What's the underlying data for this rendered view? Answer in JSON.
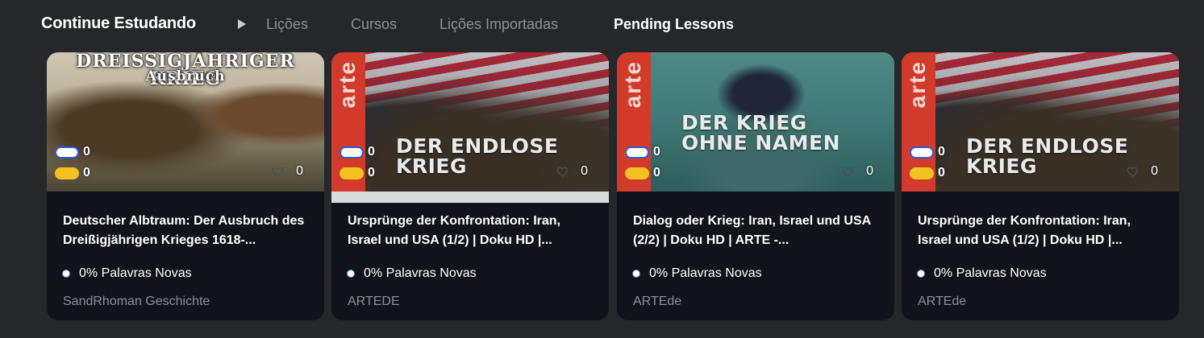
{
  "header": {
    "title": "Continue Estudando",
    "tabs": [
      {
        "label": "Lições",
        "active": false
      },
      {
        "label": "Cursos",
        "active": false
      },
      {
        "label": "Lições Importadas",
        "active": false
      },
      {
        "label": "Pending Lessons",
        "active": true
      }
    ]
  },
  "colors": {
    "background": "#25272b",
    "card": "#10131a",
    "muted": "#8c9097",
    "yellow_pill": "#f3c221",
    "blue_outline": "#2f5bd8"
  },
  "cards": [
    {
      "thumb_title": "Dreißigjähriger Krieg",
      "thumb_subtitle": "Ausbruch",
      "known_count": "0",
      "learning_count": "0",
      "likes": "0",
      "progress_percent": 0,
      "title": "Deutscher Albtraum: Der Ausbruch des Dreißigjährigen Krieges 1618-...",
      "new_words": "0% Palavras Novas",
      "channel": "SandRhoman Geschichte"
    },
    {
      "thumb_title": "DER ENDLOSE KRIEG",
      "logo": "arte",
      "known_count": "0",
      "learning_count": "0",
      "likes": "0",
      "progress_percent": 100,
      "title": "Ursprünge der Konfrontation: Iran, Israel und USA (1/2) | Doku HD |...",
      "new_words": "0% Palavras Novas",
      "channel": "ARTEDE"
    },
    {
      "thumb_title": "DER KRIEG OHNE NAMEN",
      "logo": "arte",
      "known_count": "0",
      "learning_count": "0",
      "likes": "0",
      "progress_percent": 0,
      "title": "Dialog oder Krieg: Iran, Israel und USA (2/2) | Doku HD | ARTE -...",
      "new_words": "0% Palavras Novas",
      "channel": "ARTEde"
    },
    {
      "thumb_title": "DER ENDLOSE KRIEG",
      "logo": "arte",
      "known_count": "0",
      "learning_count": "0",
      "likes": "0",
      "progress_percent": 0,
      "title": "Ursprünge der Konfrontation: Iran, Israel und USA (1/2) | Doku HD |...",
      "new_words": "0% Palavras Novas",
      "channel": "ARTEde"
    }
  ]
}
